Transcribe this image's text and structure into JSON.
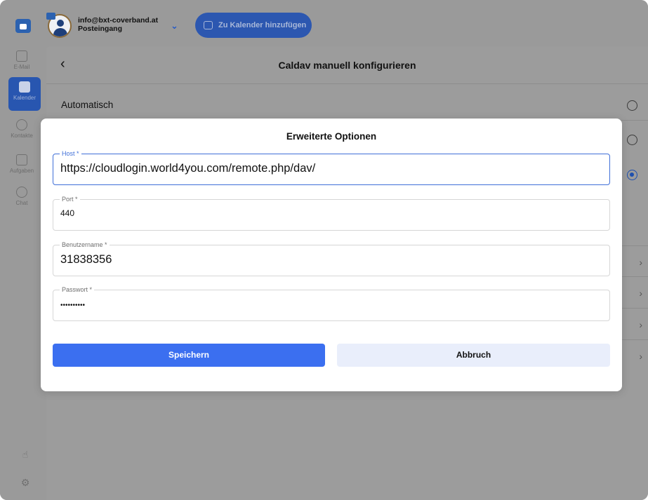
{
  "titlebar": {
    "account_email": "info@bxt-coverband.at",
    "account_folder": "Posteingang",
    "add_calendar_label": "Zu Kalender hinzufügen"
  },
  "sidebar": {
    "items": [
      {
        "label": "E-Mail",
        "icon": "inbox-icon"
      },
      {
        "label": "Kalender",
        "icon": "calendar-icon",
        "active": true
      },
      {
        "label": "Kontakte",
        "icon": "contacts-icon"
      },
      {
        "label": "Aufgaben",
        "icon": "tasks-icon"
      },
      {
        "label": "Chat",
        "icon": "chat-icon"
      }
    ],
    "bottom_icons": [
      "thumbs-up-icon",
      "gear-icon"
    ]
  },
  "content": {
    "title": "Caldav manuell konfigurieren",
    "automatic_label": "Automatisch"
  },
  "modal": {
    "title": "Erweiterte Optionen",
    "fields": {
      "host": {
        "label": "Host *",
        "value": "https://cloudlogin.world4you.com/remote.php/dav/"
      },
      "port": {
        "label": "Port *",
        "value": "440"
      },
      "username": {
        "label": "Benutzername *",
        "value": "31838356"
      },
      "password": {
        "label": "Passwort *",
        "value": "••••••••••"
      }
    },
    "save_label": "Speichern",
    "cancel_label": "Abbruch"
  },
  "colors": {
    "accent": "#3b6ff0",
    "overlay_gray": "#9a9a9a",
    "cancel_bg": "#e9eefb"
  }
}
